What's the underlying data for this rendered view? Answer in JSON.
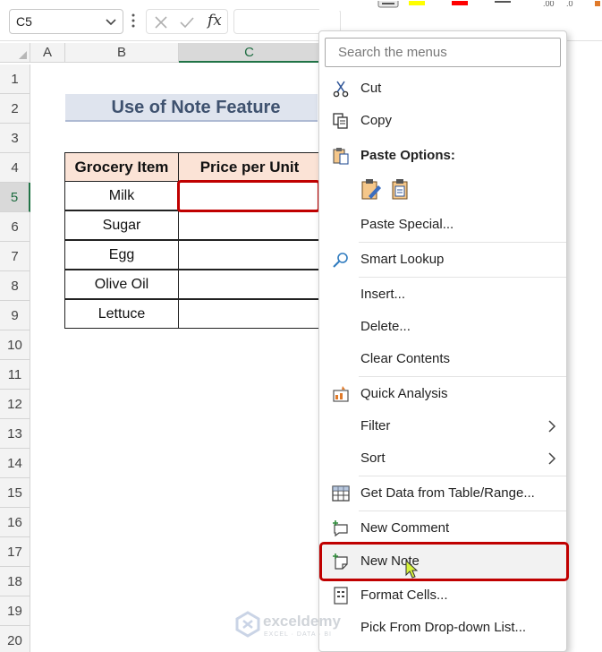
{
  "formula_bar": {
    "name_box": "C5",
    "fx_label": "fx",
    "formula_value": ""
  },
  "columns": [
    "A",
    "B",
    "C"
  ],
  "rows": [
    "1",
    "2",
    "3",
    "4",
    "5",
    "6",
    "7",
    "8",
    "9",
    "10",
    "11",
    "12",
    "13",
    "14",
    "15",
    "16",
    "17",
    "18",
    "19",
    "20"
  ],
  "sheet": {
    "title": "Use of Note Feature",
    "table_headers": [
      "Grocery Item",
      "Price per Unit"
    ],
    "items": [
      "Milk",
      "Sugar",
      "Egg",
      "Olive Oil",
      "Lettuce"
    ],
    "selected_cell": "C5"
  },
  "context_menu": {
    "search_placeholder": "Search the menus",
    "items": [
      {
        "label": "Cut",
        "icon": "scissors-icon"
      },
      {
        "label": "Copy",
        "icon": "copy-icon"
      },
      {
        "label": "Paste Options:",
        "icon": "paste-icon"
      },
      {
        "label": "Paste Special...",
        "icon": ""
      },
      {
        "label": "Smart Lookup",
        "icon": "search-icon"
      },
      {
        "label": "Insert...",
        "icon": ""
      },
      {
        "label": "Delete...",
        "icon": ""
      },
      {
        "label": "Clear Contents",
        "icon": ""
      },
      {
        "label": "Quick Analysis",
        "icon": "quick-analysis-icon"
      },
      {
        "label": "Filter",
        "icon": "",
        "submenu": true
      },
      {
        "label": "Sort",
        "icon": "",
        "submenu": true
      },
      {
        "label": "Get Data from Table/Range...",
        "icon": "table-icon"
      },
      {
        "label": "New Comment",
        "icon": "new-comment-icon"
      },
      {
        "label": "New Note",
        "icon": "new-note-icon",
        "highlighted": true
      },
      {
        "label": "Format Cells...",
        "icon": "format-cells-icon"
      },
      {
        "label": "Pick From Drop-down List...",
        "icon": ""
      }
    ]
  },
  "watermark": {
    "name": "exceldemy",
    "tagline": "EXCEL · DATA · BI"
  },
  "colors": {
    "title_fill": "#dfe4ee",
    "header_fill": "#fbe3d6",
    "highlight_red": "#c00000",
    "excel_green": "#217346"
  }
}
